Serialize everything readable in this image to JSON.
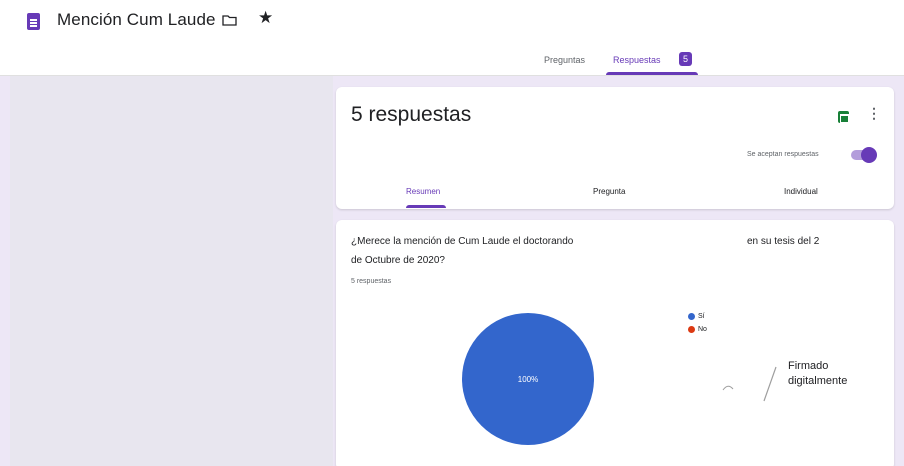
{
  "header": {
    "title": "Mención Cum Laude",
    "doc_icon": "forms-doc-icon",
    "folder_icon": "folder-icon",
    "star_icon": "star-icon"
  },
  "tabs": {
    "preguntas": "Preguntas",
    "respuestas": "Respuestas",
    "respuestas_count": "5",
    "active": "Respuestas"
  },
  "summary_card": {
    "title": "5 respuestas",
    "sheets_icon": "sheets-icon",
    "more_icon": "more-vert-icon",
    "accepting_label": "Se aceptan respuestas",
    "accepting_enabled": true,
    "subtabs": [
      "Resumen",
      "Pregunta",
      "Individual"
    ],
    "active_subtab": "Resumen"
  },
  "question_card": {
    "question_part1": "¿Merece la mención de Cum Laude el doctorando",
    "question_part2": "en su tesis del 2",
    "question_part3": "de Octubre de 2020?",
    "responses": "5 respuestas",
    "signature_line1": "Firmado",
    "signature_line2": "digitalmente"
  },
  "colors": {
    "accent": "#673ab7",
    "si": "#3366cc",
    "no": "#dc3912"
  },
  "chart_data": {
    "type": "pie",
    "categories": [
      "Sí",
      "No"
    ],
    "values": [
      100,
      0
    ],
    "labels": [
      "100%",
      ""
    ],
    "legend_position": "top-right"
  }
}
